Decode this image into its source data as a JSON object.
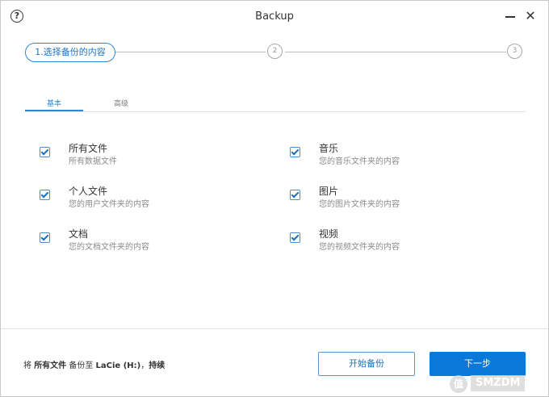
{
  "window": {
    "title": "Backup",
    "help_glyph": "?",
    "close_glyph": "✕"
  },
  "stepper": {
    "step1_label": "1.选择备份的内容",
    "step2_label": "2",
    "step3_label": "3"
  },
  "tabs": [
    {
      "label": "基本",
      "active": true
    },
    {
      "label": "高级",
      "active": false
    }
  ],
  "options": [
    {
      "title": "所有文件",
      "desc": "所有数据文件",
      "checked": true
    },
    {
      "title": "音乐",
      "desc": "您的音乐文件夹的内容",
      "checked": true
    },
    {
      "title": "个人文件",
      "desc": "您的用户文件夹的内容",
      "checked": true
    },
    {
      "title": "图片",
      "desc": "您的图片文件夹的内容",
      "checked": true
    },
    {
      "title": "文档",
      "desc": "您的文档文件夹的内容",
      "checked": true
    },
    {
      "title": "视频",
      "desc": "您的视频文件夹的内容",
      "checked": true
    }
  ],
  "footer": {
    "summary_prefix": "将 ",
    "summary_target": "所有文件",
    "summary_mid": " 备份至 ",
    "summary_drive": "LaCie (H:)",
    "summary_sep": "，",
    "summary_freq": "持续",
    "start_button": "开始备份",
    "next_button": "下一步"
  },
  "watermark": {
    "badge": "值",
    "text": "SMZDM"
  },
  "colors": {
    "accent": "#2f87d4",
    "primary_button": "#0a78d7"
  }
}
